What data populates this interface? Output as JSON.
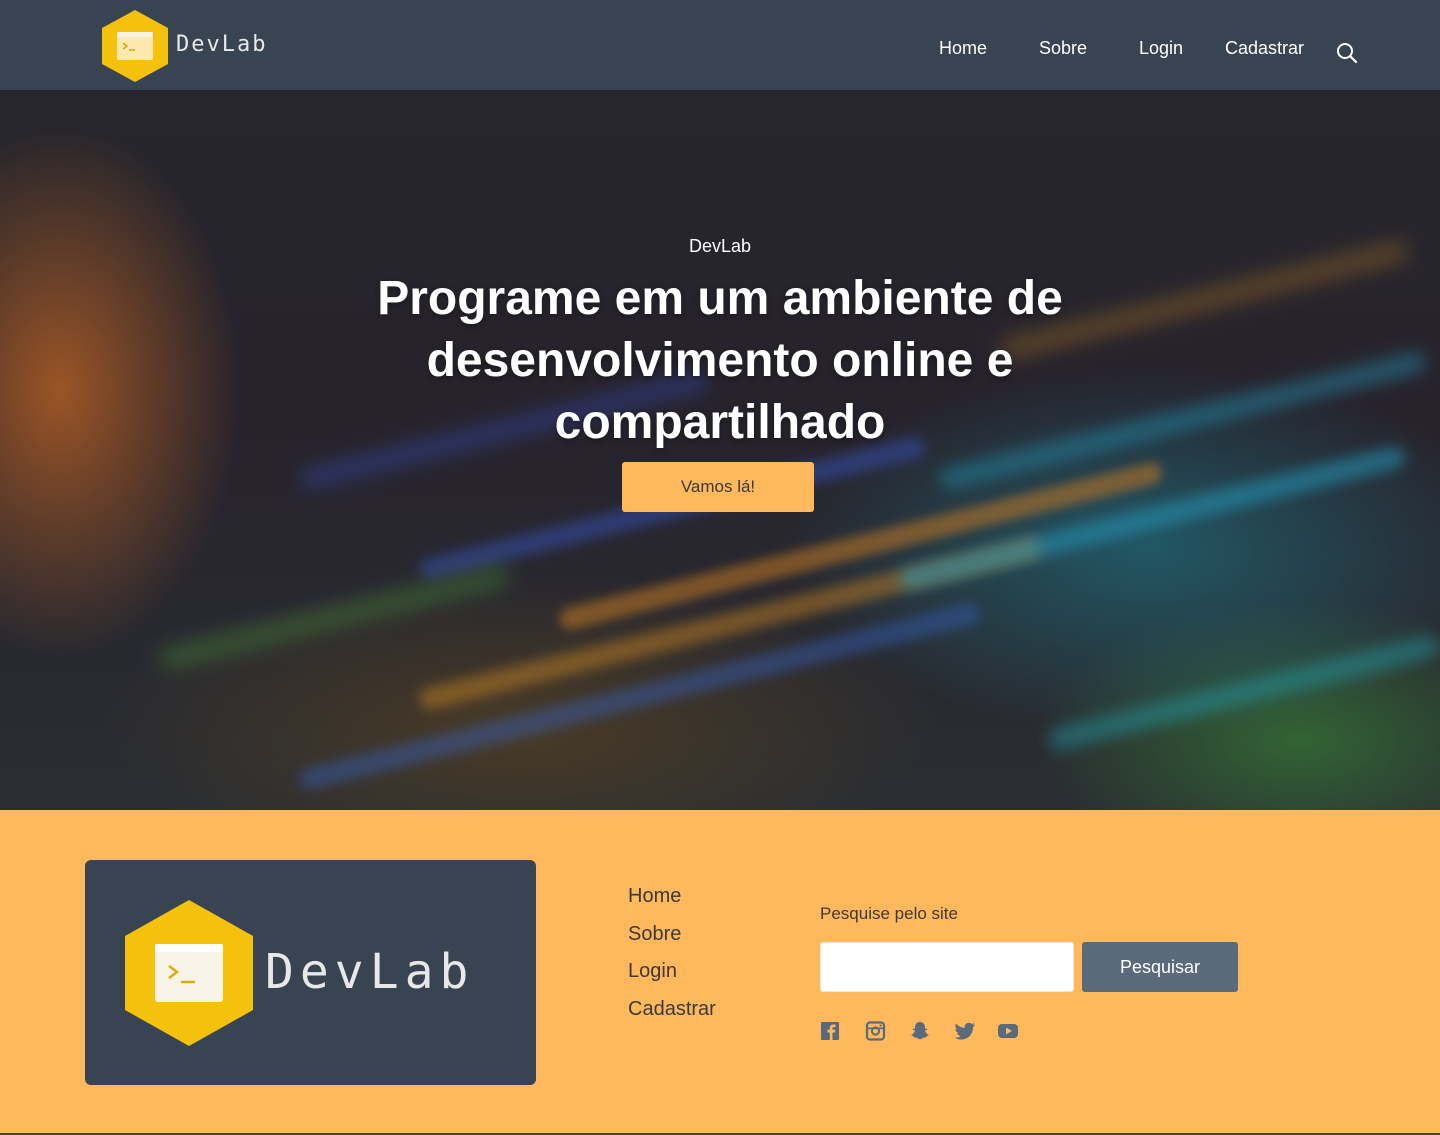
{
  "brand": {
    "name": "DevLab"
  },
  "nav": {
    "items": [
      {
        "label": "Home"
      },
      {
        "label": "Sobre"
      },
      {
        "label": "Login"
      },
      {
        "label": "Cadastrar"
      }
    ],
    "search_icon": "search-icon"
  },
  "hero": {
    "eyebrow": "DevLab",
    "title": "Programe em um ambiente de desenvolvimento online e compartilhado",
    "cta_label": "Vamos lá!",
    "background": "blurred code editor photo"
  },
  "footer": {
    "brand_name": "DevLab",
    "links": [
      {
        "label": "Home"
      },
      {
        "label": "Sobre"
      },
      {
        "label": "Login"
      },
      {
        "label": "Cadastrar"
      }
    ],
    "search": {
      "label": "Pesquise pelo site",
      "value": "",
      "placeholder": "",
      "button_label": "Pesquisar"
    },
    "socials": [
      "facebook-icon",
      "instagram-icon",
      "snapchat-icon",
      "twitter-icon",
      "youtube-icon"
    ]
  },
  "colors": {
    "nav_bg": "#394452",
    "accent": "#ffb85c",
    "logo_hex": "#f4c20d",
    "footer_button": "#5a6a7b",
    "text_dark": "#3a3a3a"
  }
}
